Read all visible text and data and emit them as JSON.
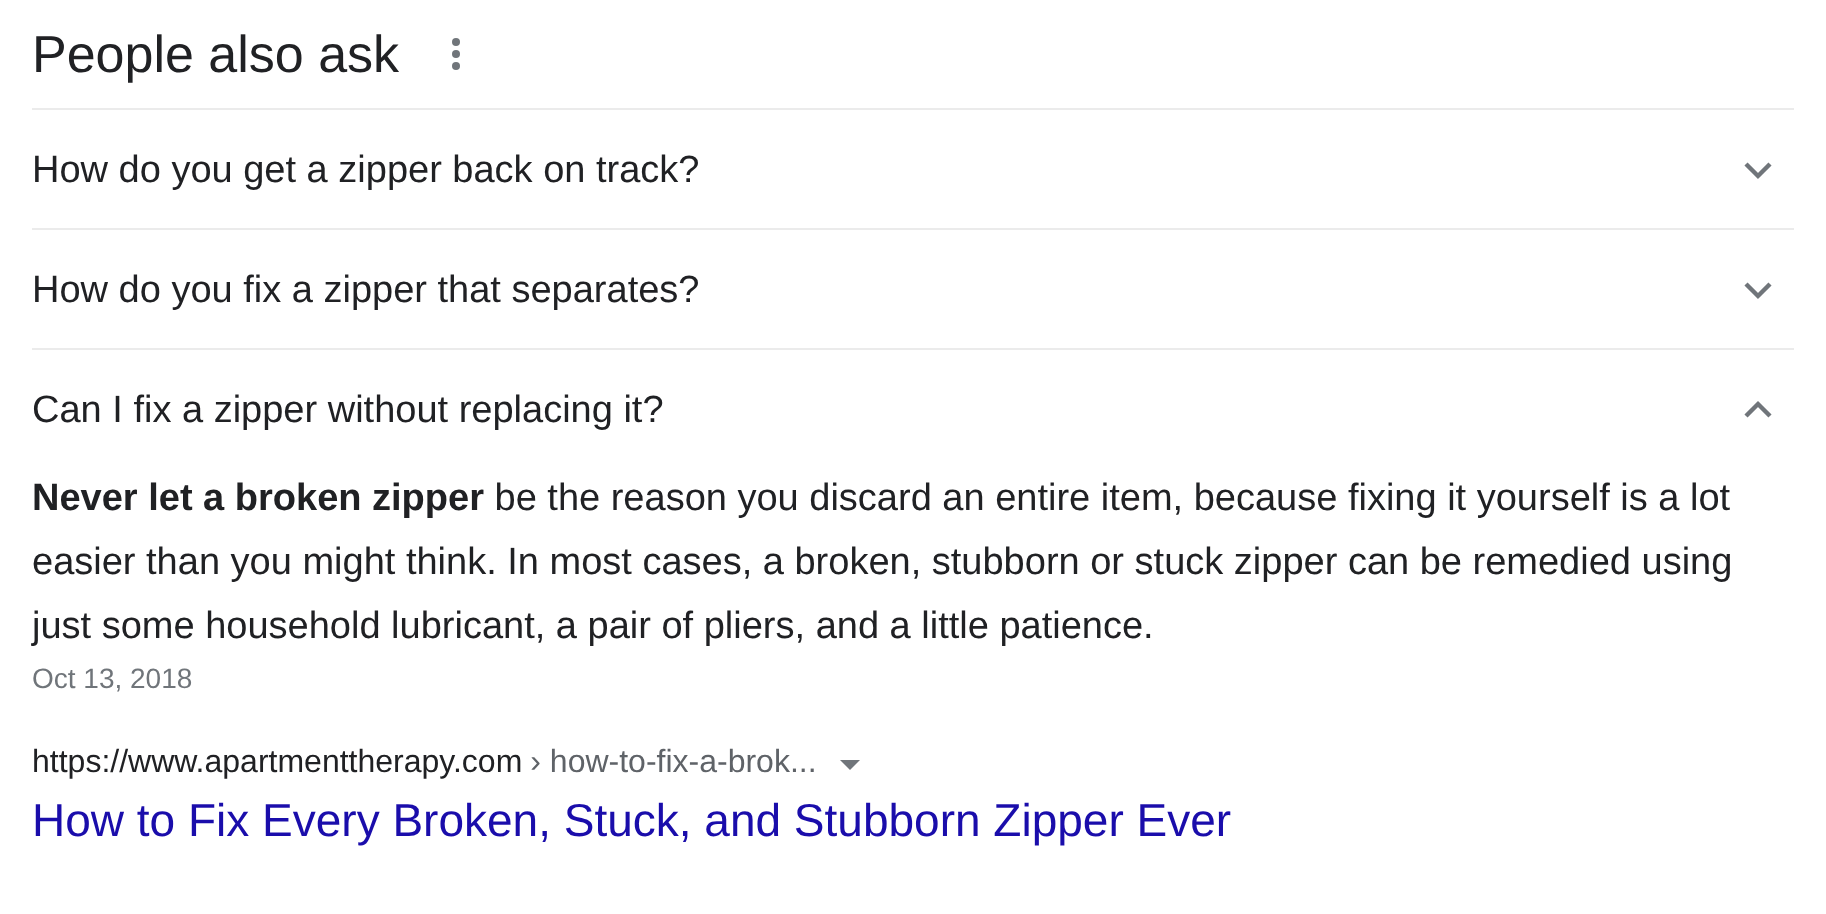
{
  "heading": "People also ask",
  "questions": [
    {
      "text": "How do you get a zipper back on track?",
      "expanded": false
    },
    {
      "text": "How do you fix a zipper that separates?",
      "expanded": false
    },
    {
      "text": "Can I fix a zipper without replacing it?",
      "expanded": true,
      "answer": {
        "snippet": "**Never let a broken zipper** be the reason you discard an entire item, because fixing it yourself is a lot easier than you might think. In most cases, a broken, stubborn or stuck zipper can be remedied using just some household lubricant, a pair of pliers, and a little patience.",
        "date": "Oct 13, 2018",
        "site": "https://www.apartmenttherapy.com",
        "path": "› how-to-fix-a-brok...",
        "title": "How to Fix Every Broken, Stuck, and Stubborn Zipper Ever"
      }
    }
  ]
}
